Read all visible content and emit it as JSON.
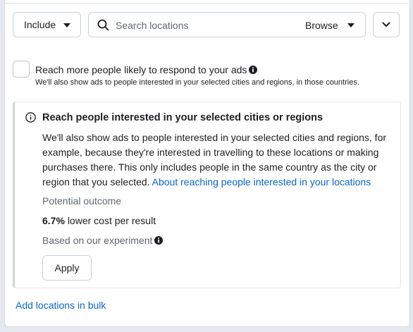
{
  "toolbar": {
    "include_label": "Include",
    "search_placeholder": "Search locations",
    "browse_label": "Browse"
  },
  "expand_option": {
    "title": "Reach more people likely to respond to your ads",
    "subtitle": "We'll also show ads to people interested in your selected cities and regions, in those countries.",
    "checked": false
  },
  "info_card": {
    "title": "Reach people interested in your selected cities or regions",
    "body": "We'll also show ads to people interested in your selected cities and regions, for example, because they're interested in travelling to these locations or making purchases there. This only includes people in the same country as the city or region that you selected.",
    "link": "About reaching people interested in your locations",
    "outcome_label": "Potential outcome",
    "outcome_value": "6.7%",
    "outcome_text": "lower cost per result",
    "experiment_label": "Based on our experiment",
    "apply_label": "Apply"
  },
  "bulk_link": "Add locations in bulk",
  "colors": {
    "link": "#0a66c2",
    "text": "#1c1e21",
    "muted": "#606770",
    "border": "#ccd0d5",
    "background": "#e4e8ef"
  }
}
